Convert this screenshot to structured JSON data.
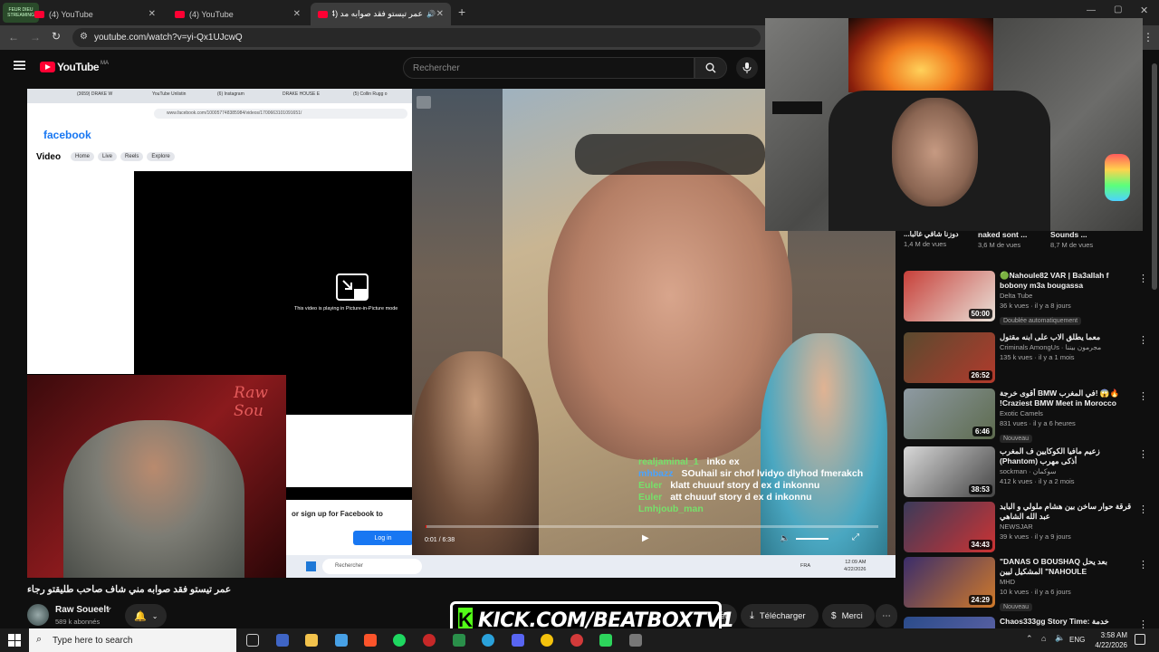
{
  "tabs": [
    {
      "label": "(4) YouTube"
    },
    {
      "label": "(4) YouTube"
    },
    {
      "label": "عمر تيستو فقد صوابه مد (4)"
    }
  ],
  "address": {
    "url": "youtube.com/watch?v=yi-Qx1UJcwQ"
  },
  "youtube": {
    "logo": "YouTube",
    "region": "MA",
    "search_placeholder": "Rechercher"
  },
  "facebook_window": {
    "tabs": [
      "(3659) DRAKE W",
      "YouTube Unlistin",
      "(6) Instagram",
      "DRAKE HOUSE E",
      "(5) Collin Rugg o"
    ],
    "url": "www.facebook.com/100057748385984/videos/1700663101091651/",
    "brand": "facebook",
    "section": "Video",
    "nav": [
      "Home",
      "Live",
      "Reels",
      "Explore"
    ],
    "pip_text": "This video is playing in Picture-in-Picture mode",
    "signup": "or sign up for Facebook to",
    "login": "Log in",
    "taskbar_search": "Rechercher",
    "tray_lang": "FRA",
    "clock_time": "12:09 AM",
    "clock_date": "4/22/2026"
  },
  "streamer_cam": {
    "overlay_text": "Raw Sou"
  },
  "player": {
    "time": "0:01 / 6:38",
    "chat": [
      {
        "user": "realjaminal_1",
        "msg": "inko ex"
      },
      {
        "user": "mhbazz",
        "msg": "SOuhail sir chof lvidyo dlyhod fmerakch"
      },
      {
        "user": "Euler",
        "msg": "klatt chuuuf story d ex d inkonnu"
      },
      {
        "user": "Euler",
        "msg": "att chuuuf story d ex d inkonnu"
      },
      {
        "user": "Lmhjoub_man",
        "msg": ""
      }
    ]
  },
  "video": {
    "title": "عمر تيستو فقد صوابه مني شاف صاحب طليقتو رجاء",
    "channel": "Raw Soueelt",
    "subscribers": "589 k abonnés"
  },
  "actions": {
    "partial": "ger",
    "download": "Télécharger",
    "thanks": "Merci"
  },
  "kick_banner": "KICK.COM/BEATBOXTV1",
  "top_row": [
    {
      "title": "...دوزنا شاقي غالبا",
      "meta": "1,4 M de vues"
    },
    {
      "title": "naked sont ...",
      "meta": "3,6 M de vues"
    },
    {
      "title": "Sounds ...",
      "meta": "8,7 M de vues"
    }
  ],
  "recommendations": [
    {
      "title": "🟢Nahoule82 VAR | Ba3allah f bobony m3a bougassa",
      "channel": "Delta Tube",
      "meta": "36 k vues · il y a 8 jours",
      "badge": "Doublée automatiquement",
      "duration": "50:00",
      "colors": [
        "#c7403a",
        "#e9e1d8"
      ]
    },
    {
      "title": "معما يطلق الاب على ابنه مقتول",
      "channel": "Criminals AmongUs · مجرمون بيننا",
      "meta": "135 k vues · il y a 1 mois",
      "badge": "",
      "duration": "26:52",
      "colors": [
        "#5a4a2f",
        "#b23a2c"
      ]
    },
    {
      "title": "أقوى خرجة BMW في المغرب! 😱🔥 !Craziest BMW Meet in Morocco",
      "channel": "Exotic Camels",
      "meta": "831 vues · il y a 6 heures",
      "badge": "Nouveau",
      "duration": "6:46",
      "colors": [
        "#8e9aa3",
        "#5d6b4e"
      ]
    },
    {
      "title": "زعيم مافيا الكوكايين ف المغرب (Phantom) أذكى مهرب",
      "channel": "sockman · سوكمان",
      "meta": "412 k vues · il y a 2 mois",
      "badge": "",
      "duration": "38:53",
      "colors": [
        "#d8d8d8",
        "#444"
      ]
    },
    {
      "title": "قرقة حوار ساخن بين هشام ملولي و البايد عبد الله الشاهي",
      "channel": "NEWSJAR",
      "meta": "39 k vues · il y a 9 jours",
      "badge": "",
      "duration": "34:43",
      "colors": [
        "#3b3b5a",
        "#c33"
      ]
    },
    {
      "title": "\"DANAS O BOUSHAQ بعد يحل المشكيل ليين \"NAHOULE",
      "channel": "MHD",
      "meta": "10 k vues · il y a 6 jours",
      "badge": "Nouveau",
      "duration": "24:29",
      "colors": [
        "#3a2d6b",
        "#d07a2a"
      ]
    },
    {
      "title": "Chaos333gg Story Time: خدمة",
      "channel": "",
      "meta": "",
      "badge": "",
      "duration": "",
      "colors": [
        "#2a4b8a",
        "#66a"
      ]
    }
  ],
  "taskbar": {
    "search_placeholder": "Type here to search",
    "lang": "ENG",
    "time": "3:58 AM",
    "date": "4/22/2026"
  },
  "watermark": "FEUR DIEU STREAMING"
}
